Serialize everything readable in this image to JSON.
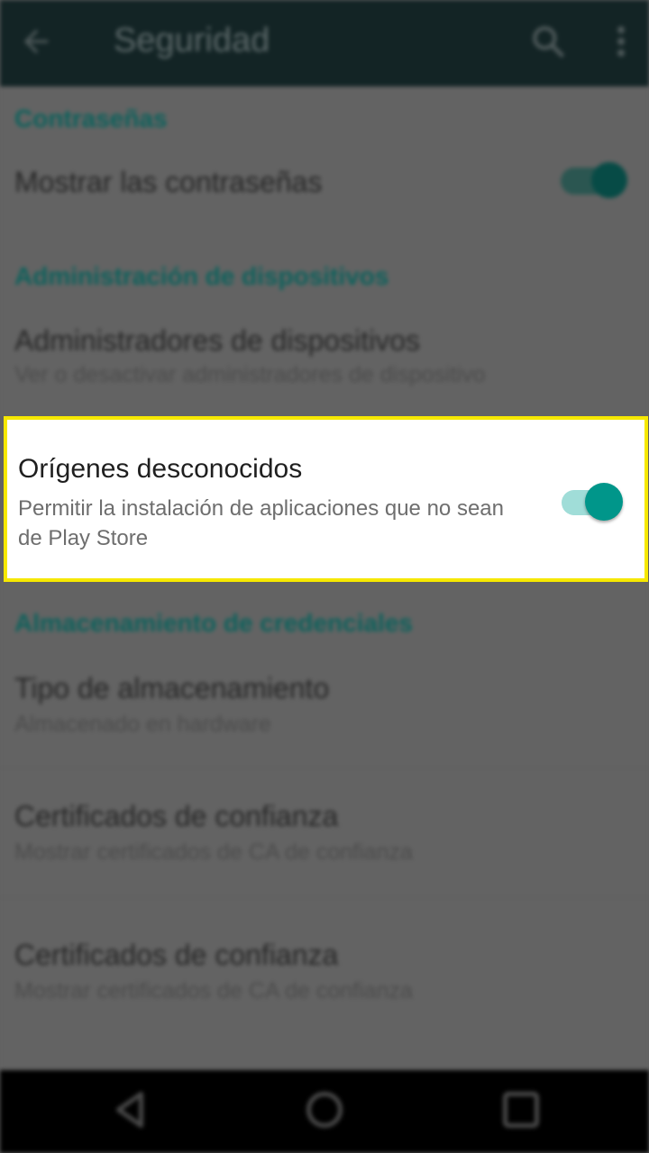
{
  "appbar": {
    "title": "Seguridad",
    "back_icon": "arrow-back-icon",
    "search_icon": "search-icon",
    "more_icon": "more-vert-icon"
  },
  "sections": {
    "passwords": {
      "header": "Contraseñas",
      "show_passwords": {
        "title": "Mostrar las contraseñas",
        "toggle_on": true
      }
    },
    "device_admin": {
      "header": "Administración de dispositivos",
      "admins": {
        "title": "Administradores de dispositivos",
        "subtitle": "Ver o desactivar administradores de dispositivo"
      }
    },
    "unknown_sources": {
      "title": "Orígenes desconocidos",
      "subtitle": "Permitir la instalación de aplicaciones que no sean de Play Store",
      "toggle_on": true
    },
    "credentials": {
      "header": "Almacenamiento de credenciales",
      "storage_type": {
        "title": "Tipo de almacenamiento",
        "subtitle": "Almacenado en hardware"
      },
      "trusted_certs": {
        "title": "Certificados de confianza",
        "subtitle": "Mostrar certificados de CA de confianza"
      },
      "trusted_certs_2": {
        "title": "Certificados de confianza",
        "subtitle": "Mostrar certificados de CA de confianza"
      }
    }
  },
  "navbar": {
    "back_icon": "nav-back-icon",
    "home_icon": "nav-home-icon",
    "recents_icon": "nav-recents-icon"
  },
  "colors": {
    "accent": "#00968a",
    "accent_track": "#a0ddd8",
    "highlight_border": "#f6e800",
    "dim_overlay": "#616161"
  }
}
